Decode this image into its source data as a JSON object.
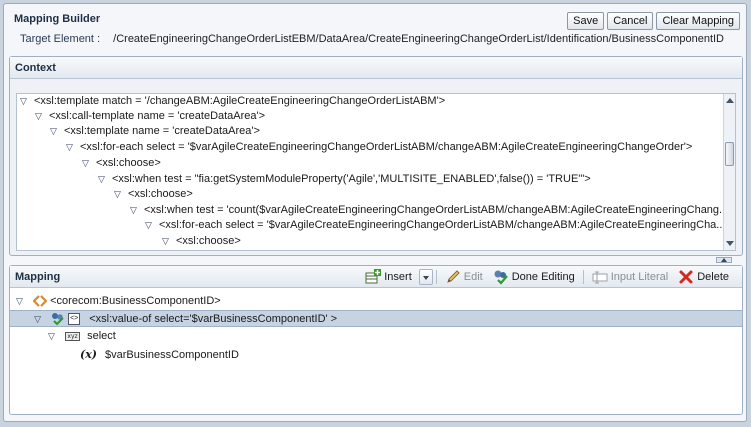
{
  "header": {
    "title": "Mapping Builder",
    "buttons": {
      "save": "Save",
      "cancel": "Cancel",
      "clear": "Clear Mapping"
    },
    "target_label": "Target Element :",
    "target_value": "/CreateEngineeringChangeOrderListEBM/DataArea/CreateEngineeringChangeOrderList/Identification/BusinessComponentID"
  },
  "context": {
    "title": "Context",
    "lines": [
      "<xsl:template match = '/changeABM:AgileCreateEngineeringChangeOrderListABM'>",
      "<xsl:call-template name = 'createDataArea'>",
      "<xsl:template name = 'createDataArea'>",
      "<xsl:for-each select = '$varAgileCreateEngineeringChangeOrderListABM/changeABM:AgileCreateEngineeringChangeOrder'>",
      "<xsl:choose>",
      "<xsl:when test = \"fia:getSystemModuleProperty('Agile','MULTISITE_ENABLED',false()) = 'TRUE'\">",
      "<xsl:choose>",
      "<xsl:when test = 'count($varAgileCreateEngineeringChangeOrderListABM/changeABM:AgileCreateEngineeringChang...",
      "<xsl:for-each select = '$varAgileCreateEngineeringChangeOrderListABM/changeABM:AgileCreateEngineeringCha...",
      "<xsl:choose>"
    ]
  },
  "mapping": {
    "title": "Mapping",
    "toolbar": {
      "insert": "Insert",
      "edit": "Edit",
      "done": "Done Editing",
      "input_literal": "Input Literal",
      "delete": "Delete"
    },
    "tree": {
      "root": "<corecom:BusinessComponentID>",
      "value_of": "<xsl:value-of select='$varBusinessComponentID' >",
      "select_label": "select",
      "variable": "$varBusinessComponentID"
    }
  },
  "colors": {
    "selection": "#c6d3e2",
    "panel_border": "#9fb0c3",
    "delete_icon": "#d32a1e"
  }
}
